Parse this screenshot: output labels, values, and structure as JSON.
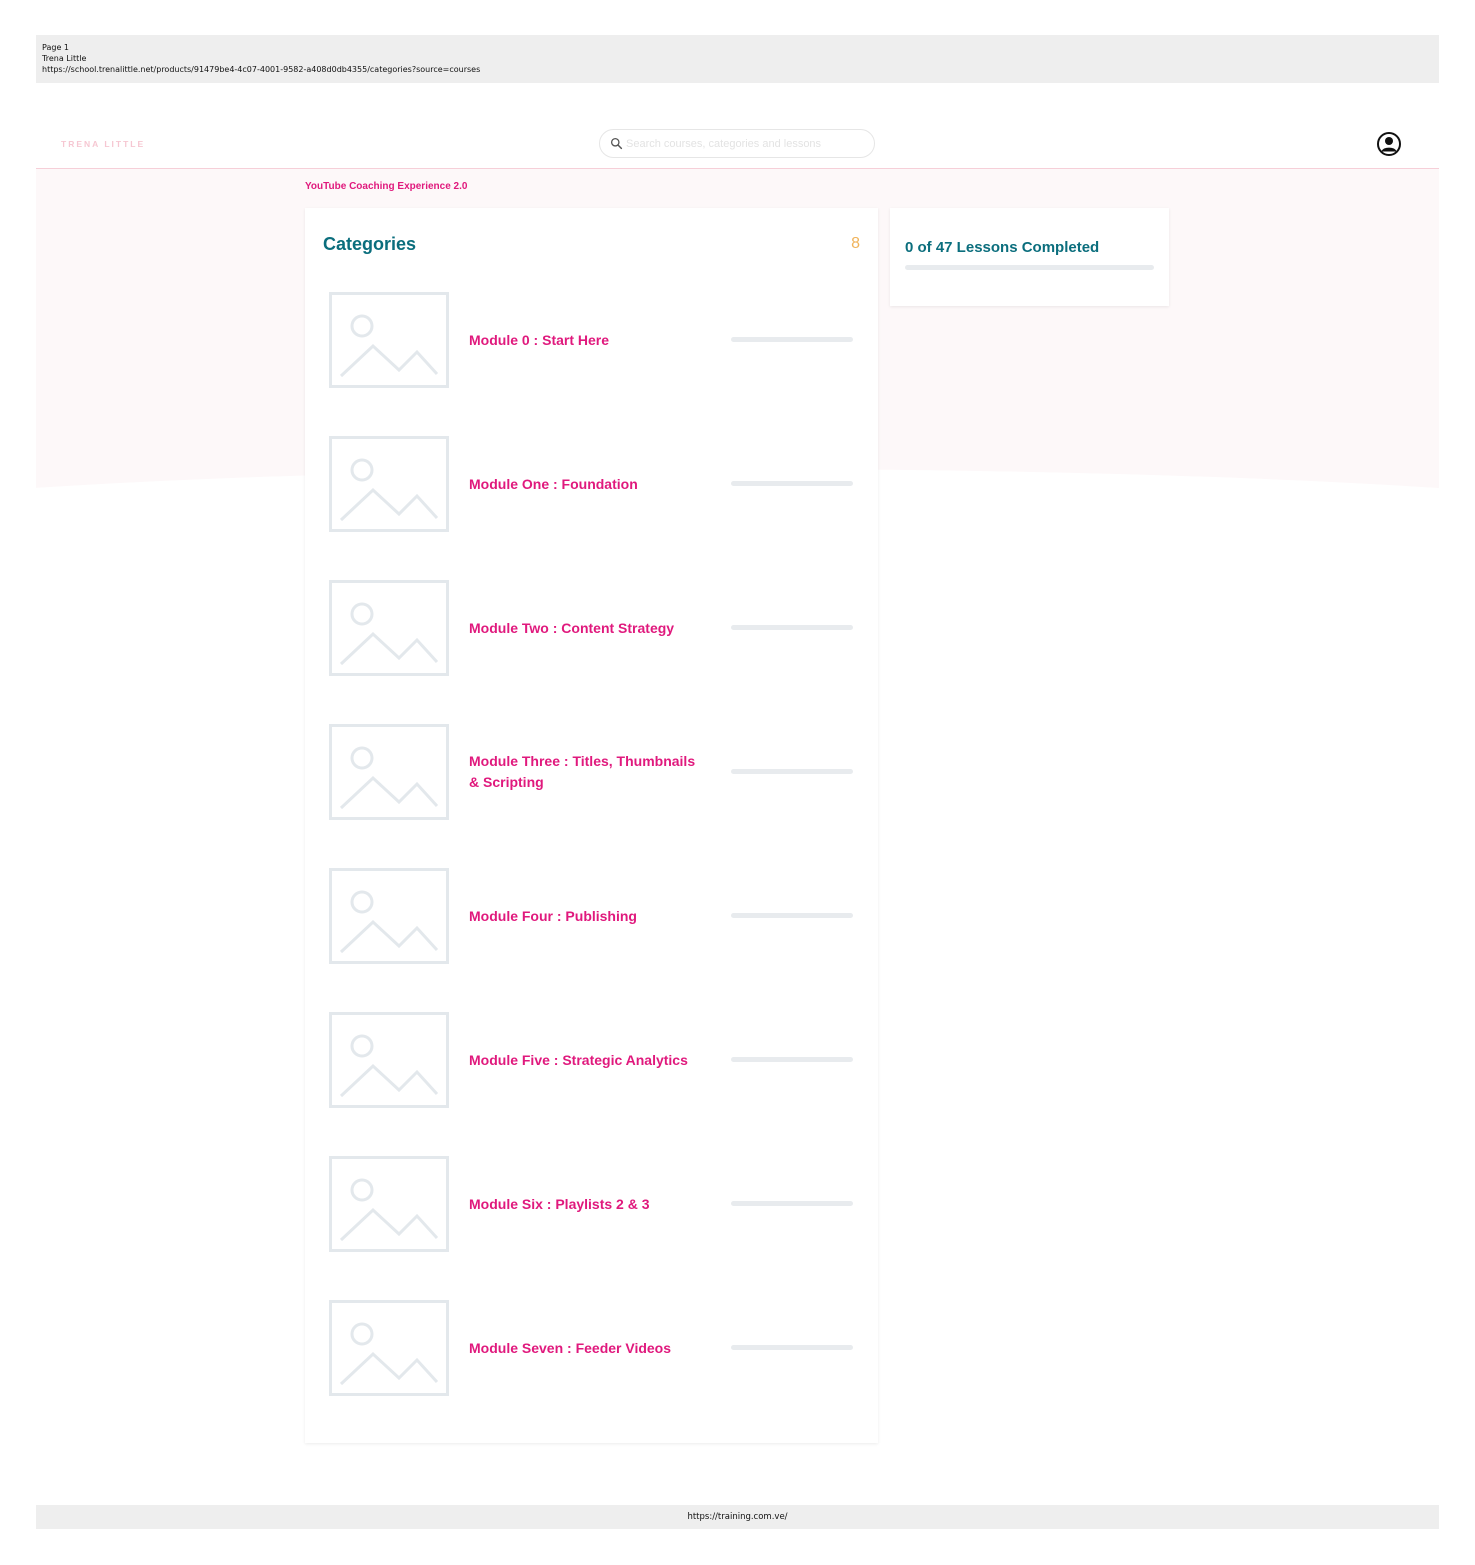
{
  "print_header": {
    "page": "Page 1",
    "title": "Trena Little",
    "url": "https://school.trenalittle.net/products/91479be4-4c07-4001-9582-a408d0db4355/categories?source=courses"
  },
  "print_footer": {
    "url": "https://training.com.ve/"
  },
  "header": {
    "logo": "TRENA LITTLE",
    "search_placeholder": "Search courses, categories and lessons",
    "account_icon": "account-circle-icon"
  },
  "breadcrumb": "YouTube Coaching Experience 2.0",
  "categories": {
    "title": "Categories",
    "count": "8",
    "items": [
      {
        "label": "Module 0 : Start Here",
        "progress": 0
      },
      {
        "label": "Module One : Foundation",
        "progress": 0
      },
      {
        "label": "Module Two : Content Strategy",
        "progress": 0
      },
      {
        "label": "Module Three : Titles, Thumbnails & Scripting",
        "progress": 0
      },
      {
        "label": "Module Four : Publishing",
        "progress": 0
      },
      {
        "label": "Module Five : Strategic Analytics",
        "progress": 0
      },
      {
        "label": "Module Six : Playlists 2 & 3",
        "progress": 0
      },
      {
        "label": "Module Seven : Feeder Videos",
        "progress": 0
      }
    ]
  },
  "progress": {
    "text": "0 of 47 Lessons Completed",
    "completed": 0,
    "total": 47
  },
  "colors": {
    "accent": "#e0197d",
    "teal": "#0b6e7d",
    "count": "#f0b35a",
    "placeholder_image": "#e3e8ec"
  }
}
